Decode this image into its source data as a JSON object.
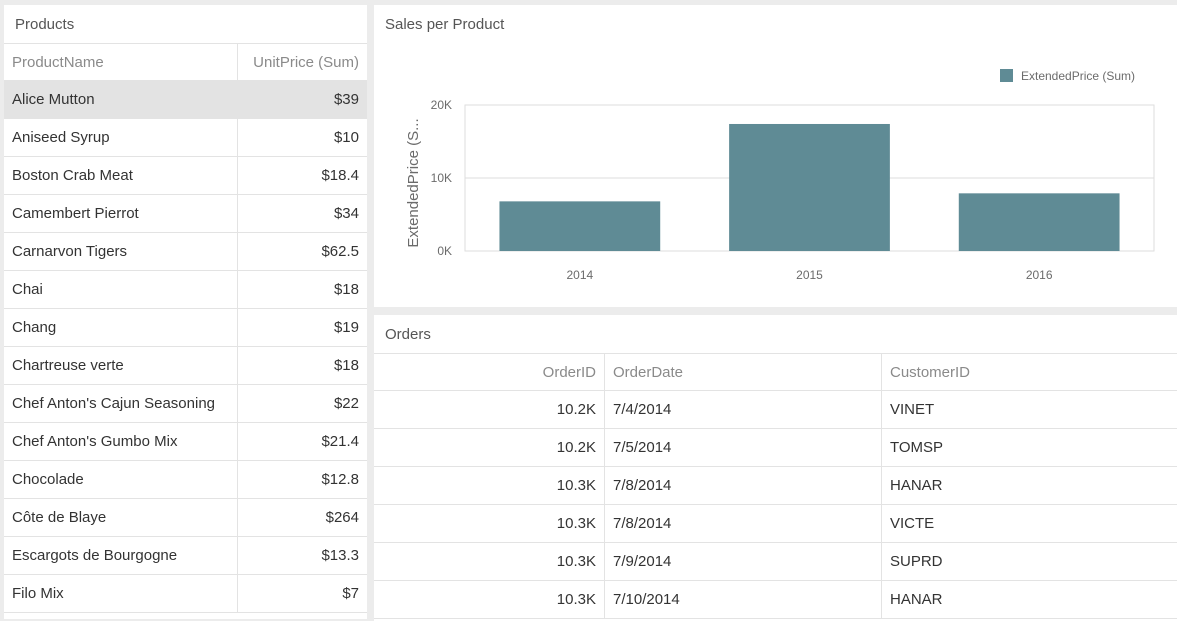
{
  "products": {
    "title": "Products",
    "columns": [
      "ProductName",
      "UnitPrice (Sum)"
    ],
    "rows": [
      {
        "name": "Alice Mutton",
        "price": "$39"
      },
      {
        "name": "Aniseed Syrup",
        "price": "$10"
      },
      {
        "name": "Boston Crab Meat",
        "price": "$18.4"
      },
      {
        "name": "Camembert Pierrot",
        "price": "$34"
      },
      {
        "name": "Carnarvon Tigers",
        "price": "$62.5"
      },
      {
        "name": "Chai",
        "price": "$18"
      },
      {
        "name": "Chang",
        "price": "$19"
      },
      {
        "name": "Chartreuse verte",
        "price": "$18"
      },
      {
        "name": "Chef Anton's Cajun Seasoning",
        "price": "$22"
      },
      {
        "name": "Chef Anton's Gumbo Mix",
        "price": "$21.4"
      },
      {
        "name": "Chocolade",
        "price": "$12.8"
      },
      {
        "name": "Côte de Blaye",
        "price": "$264"
      },
      {
        "name": "Escargots de Bourgogne",
        "price": "$13.3"
      },
      {
        "name": "Filo Mix",
        "price": "$7"
      }
    ],
    "selected_row": "Alice Mutton"
  },
  "chart": {
    "title": "Sales per Product",
    "legend_label": "ExtendedPrice (Sum)",
    "y_axis_title": "ExtendedPrice (S...",
    "bar_color": "#5f8b95"
  },
  "chart_data": {
    "type": "bar",
    "categories": [
      "2014",
      "2015",
      "2016"
    ],
    "series": [
      {
        "name": "ExtendedPrice (Sum)",
        "values": [
          6800,
          17400,
          7900
        ]
      }
    ],
    "ylim": [
      0,
      20000
    ],
    "y_ticks": [
      {
        "value": 0,
        "label": "0K"
      },
      {
        "value": 10000,
        "label": "10K"
      },
      {
        "value": 20000,
        "label": "20K"
      }
    ],
    "ylabel": "ExtendedPrice (S...",
    "xlabel": "",
    "grid": true,
    "legend_position": "top-right"
  },
  "orders": {
    "title": "Orders",
    "columns": [
      "OrderID",
      "OrderDate",
      "CustomerID"
    ],
    "rows": [
      {
        "id": "10.2K",
        "date": "7/4/2014",
        "customer": "VINET"
      },
      {
        "id": "10.2K",
        "date": "7/5/2014",
        "customer": "TOMSP"
      },
      {
        "id": "10.3K",
        "date": "7/8/2014",
        "customer": "HANAR"
      },
      {
        "id": "10.3K",
        "date": "7/8/2014",
        "customer": "VICTE"
      },
      {
        "id": "10.3K",
        "date": "7/9/2014",
        "customer": "SUPRD"
      },
      {
        "id": "10.3K",
        "date": "7/10/2014",
        "customer": "HANAR"
      }
    ]
  }
}
